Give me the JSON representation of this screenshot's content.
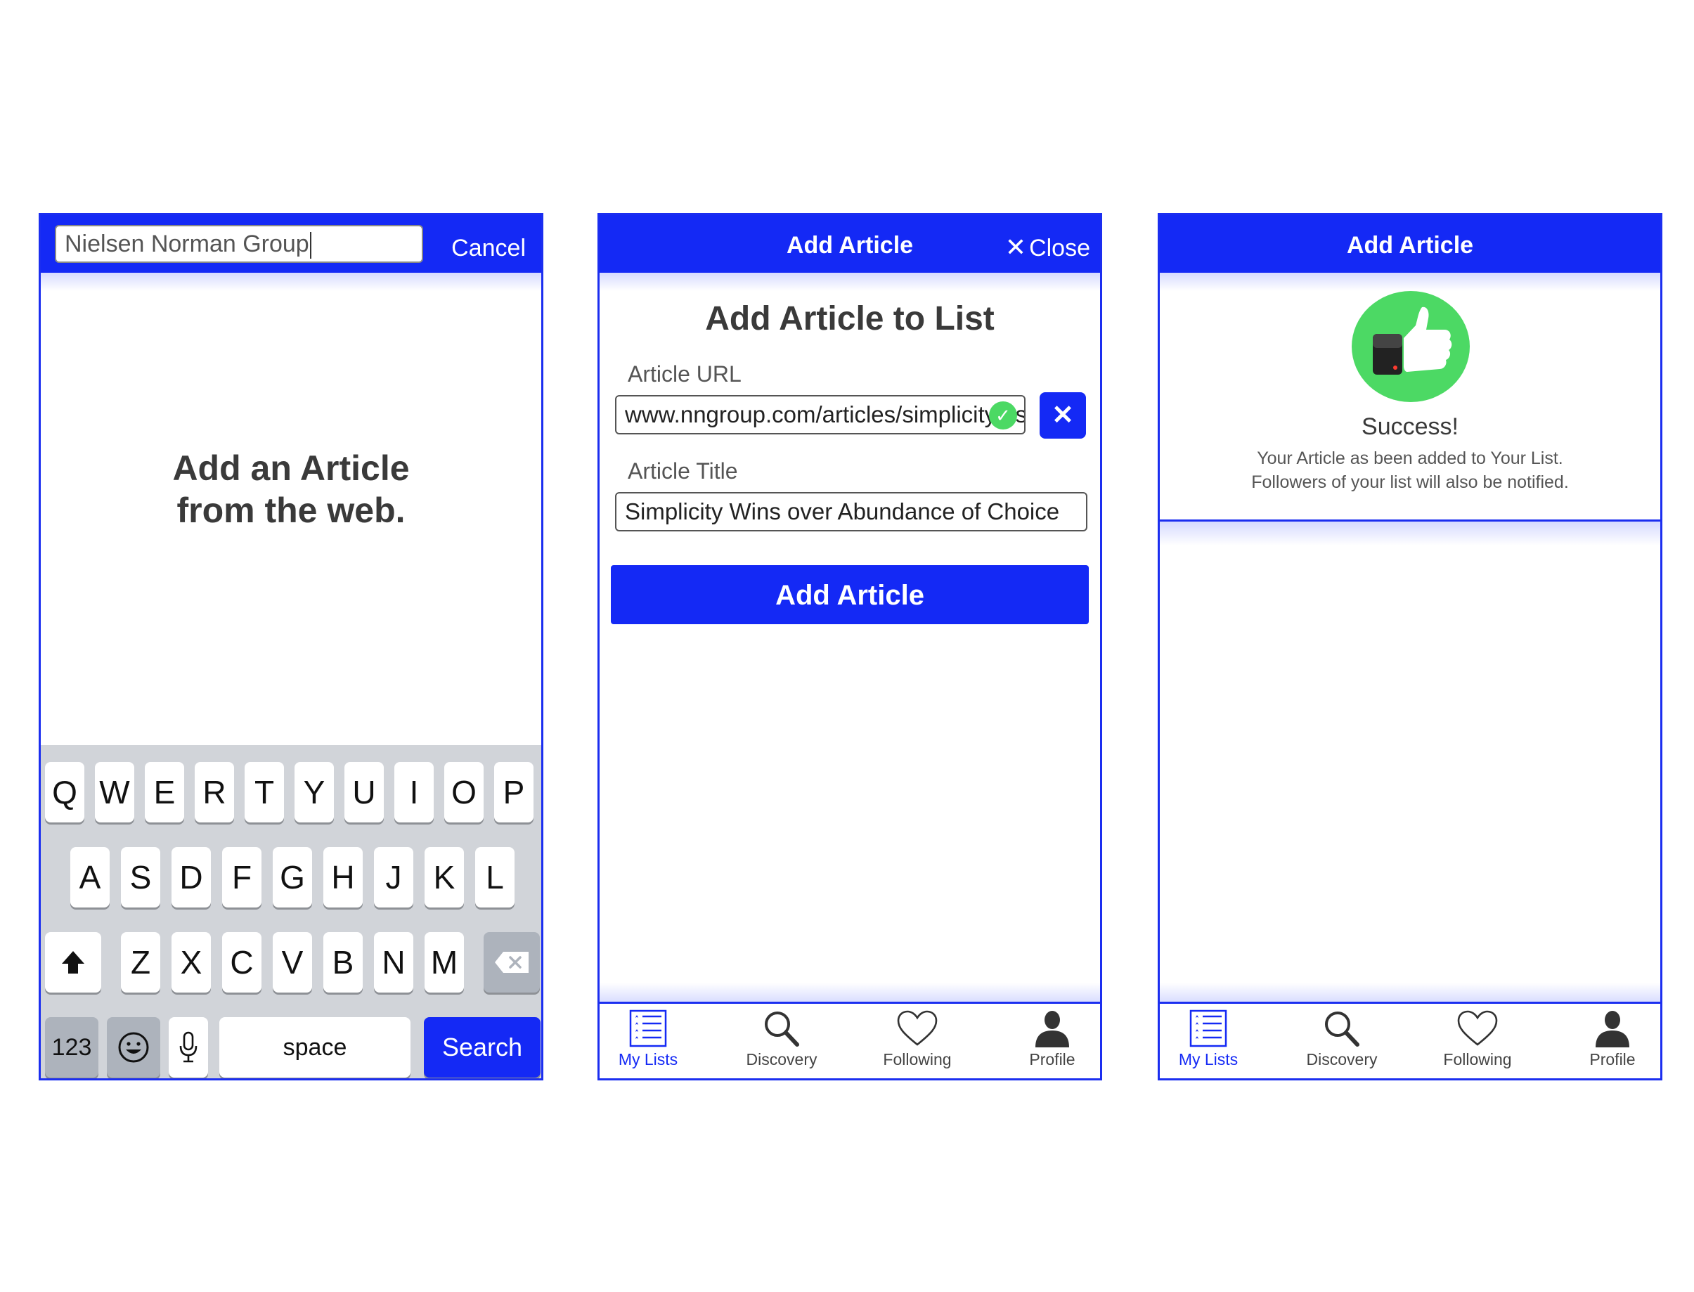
{
  "screen1": {
    "search_value": "Nielsen Norman Group",
    "cancel_label": "Cancel",
    "prompt_line1": "Add an Article",
    "prompt_line2": "from the web.",
    "keyboard": {
      "row1": [
        "Q",
        "W",
        "E",
        "R",
        "T",
        "Y",
        "U",
        "I",
        "O",
        "P"
      ],
      "row2": [
        "A",
        "S",
        "D",
        "F",
        "G",
        "H",
        "J",
        "K",
        "L"
      ],
      "row3": [
        "Z",
        "X",
        "C",
        "V",
        "B",
        "N",
        "M"
      ],
      "numbers_key": "123",
      "space_key": "space",
      "search_key": "Search"
    }
  },
  "screen2": {
    "header_title": "Add Article",
    "close_label": "Close",
    "form_title": "Add Article to List",
    "url_label": "Article URL",
    "url_value": "www.nngroup.com/articles/simplicity-vs-choice",
    "title_label": "Article Title",
    "title_value": "Simplicity Wins over Abundance of Choice",
    "submit_label": "Add Article"
  },
  "screen3": {
    "header_title": "Add Article",
    "success_title": "Success!",
    "success_line1": "Your Article as been added to Your List.",
    "success_line2": "Followers of your list will also be notified."
  },
  "tabs": [
    {
      "label": "My Lists",
      "icon": "list-icon",
      "active": true
    },
    {
      "label": "Discovery",
      "icon": "search-icon",
      "active": false
    },
    {
      "label": "Following",
      "icon": "heart-icon",
      "active": false
    },
    {
      "label": "Profile",
      "icon": "person-icon",
      "active": false
    }
  ],
  "colors": {
    "accent": "#1429f5",
    "success": "#4cd964"
  }
}
